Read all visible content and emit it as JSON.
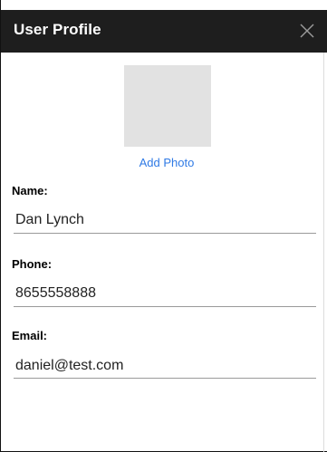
{
  "header": {
    "title": "User Profile",
    "close_icon": "close-icon"
  },
  "photo": {
    "placeholder_icon": "photo-placeholder",
    "add_label": "Add Photo"
  },
  "fields": {
    "name": {
      "label": "Name:",
      "value": "Dan Lynch"
    },
    "phone": {
      "label": "Phone:",
      "value": "8655558888"
    },
    "email": {
      "label": "Email:",
      "value": "daniel@test.com"
    }
  },
  "colors": {
    "header_bg": "#1e1e1e",
    "link": "#2f7ae5",
    "photo_bg": "#e2e2e2"
  }
}
